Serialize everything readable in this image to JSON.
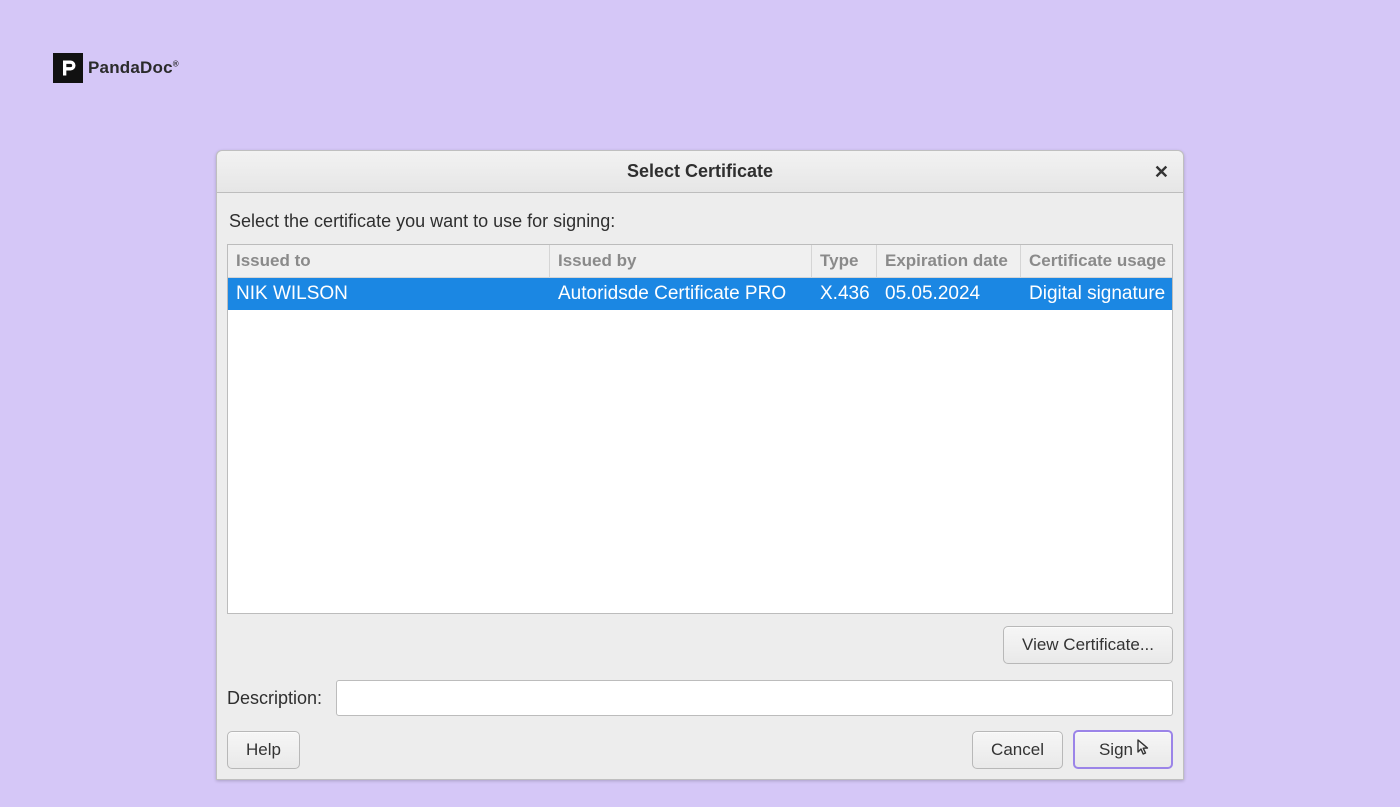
{
  "brand": {
    "name": "PandaDoc"
  },
  "dialog": {
    "title": "Select Certificate",
    "instruction": "Select the certificate you want to use for signing:",
    "columns": {
      "issued_to": "Issued to",
      "issued_by": "Issued by",
      "type": "Type",
      "expiration": "Expiration date",
      "usage": "Certificate usage"
    },
    "rows": [
      {
        "issued_to": "NIK WILSON",
        "issued_by": "Autoridsde Certificate PRO",
        "type": "X.436",
        "expiration": "05.05.2024",
        "usage": "Digital signature"
      }
    ],
    "view_cert_label": "View Certificate...",
    "description_label": "Description:",
    "description_value": "",
    "buttons": {
      "help": "Help",
      "cancel": "Cancel",
      "sign": "Sign"
    }
  }
}
